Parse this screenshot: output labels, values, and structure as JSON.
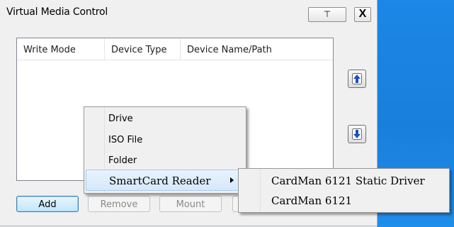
{
  "window": {
    "title": "Virtual Media Control",
    "pin_label": "⊤",
    "close_label": "X"
  },
  "list": {
    "columns": [
      "Write Mode",
      "Device Type",
      "Device Name/Path"
    ],
    "rows": []
  },
  "side_buttons": {
    "up_icon": "arrow-up-icon",
    "down_icon": "arrow-down-icon"
  },
  "buttons": {
    "add": "Add",
    "remove": "Remove",
    "mount": "Mount"
  },
  "context_menu": {
    "items": [
      "Drive",
      "ISO File",
      "Folder",
      "SmartCard Reader"
    ],
    "selected": "SmartCard Reader"
  },
  "submenu": {
    "items": [
      "CardMan 6121 Static Driver",
      "CardMan 6121"
    ]
  },
  "colors": {
    "desktop": "#1a7fdc",
    "arrow_icon": "#1b4fc4",
    "selection": "#d5e8fb"
  }
}
